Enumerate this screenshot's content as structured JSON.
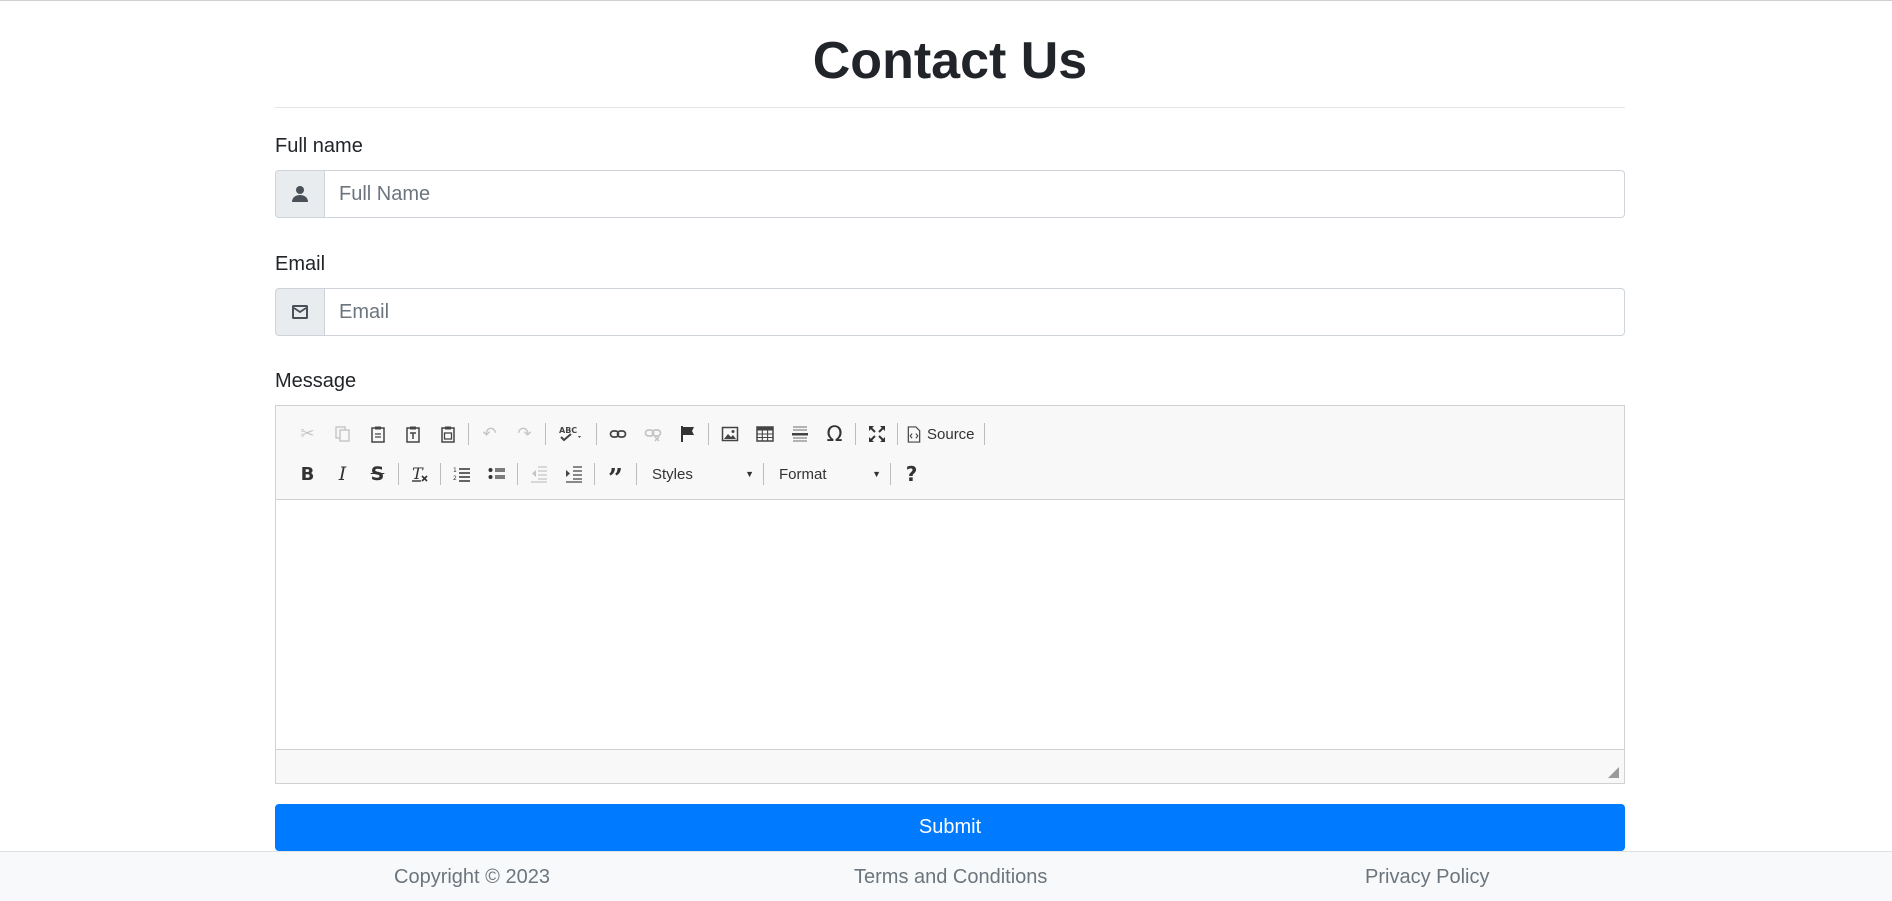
{
  "page": {
    "title": "Contact Us"
  },
  "form": {
    "full_name": {
      "label": "Full name",
      "placeholder": "Full Name",
      "icon": "user-icon"
    },
    "email": {
      "label": "Email",
      "placeholder": "Email",
      "icon": "envelope-icon"
    },
    "message": {
      "label": "Message"
    },
    "submit_label": "Submit"
  },
  "editor": {
    "toolbar_row1": [
      "cut-icon",
      "copy-icon",
      "paste-icon",
      "paste-text-icon",
      "paste-word-icon",
      "undo-icon",
      "redo-icon",
      "spellcheck-icon",
      "link-icon",
      "unlink-icon",
      "anchor-icon",
      "image-icon",
      "table-icon",
      "horizontal-line-icon",
      "special-char-icon",
      "maximize-icon",
      "source-icon"
    ],
    "source_label": "Source",
    "toolbar_row2": [
      "bold-icon",
      "italic-icon",
      "strikethrough-icon",
      "remove-format-icon",
      "numbered-list-icon",
      "bulleted-list-icon",
      "outdent-icon",
      "indent-icon",
      "blockquote-icon",
      "help-icon"
    ],
    "styles_label": "Styles",
    "format_label": "Format",
    "help_glyph": "?",
    "special_char_glyph": "Ω"
  },
  "footer": {
    "copyright": "Copyright © 2023",
    "terms": "Terms and Conditions",
    "privacy": "Privacy Policy"
  },
  "colors": {
    "primary": "#007bff",
    "footer_bg": "#f8f9fa"
  }
}
